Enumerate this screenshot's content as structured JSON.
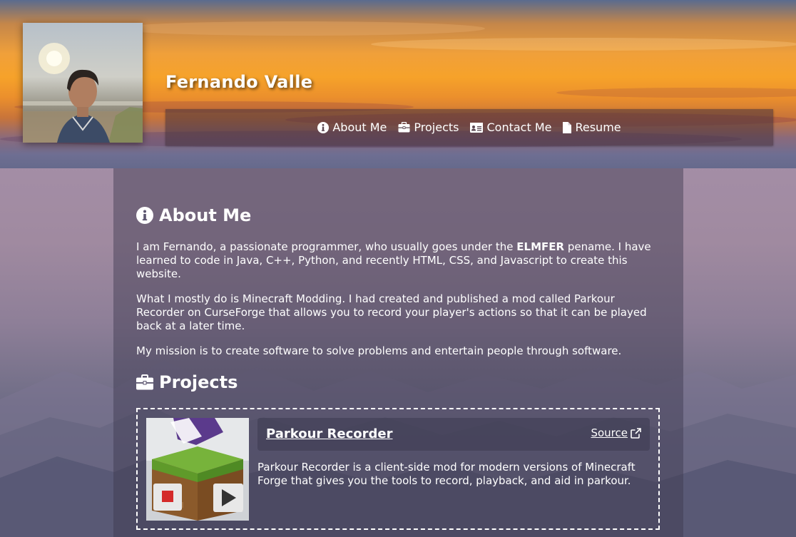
{
  "header": {
    "title": "Fernando Valle",
    "nav": [
      {
        "icon": "info-circle-icon",
        "label": "About Me"
      },
      {
        "icon": "briefcase-icon",
        "label": "Projects"
      },
      {
        "icon": "id-card-icon",
        "label": "Contact Me"
      },
      {
        "icon": "file-icon",
        "label": "Resume"
      }
    ]
  },
  "about": {
    "heading": "About Me",
    "p1_before": "I am Fernando, a passionate programmer, who usually goes under the ",
    "p1_bold": "ELMFER",
    "p1_after": " pename. I have learned to code in Java, C++, Python, and recently HTML, CSS, and Javascript to create this website.",
    "p2": "What I mostly do is Minecraft Modding. I had created and published a mod called Parkour Recorder on CurseForge that allows you to record your player's actions so that it can be played back at a later time.",
    "p3": "My mission is to create software to solve problems and entertain people through software."
  },
  "projects": {
    "heading": "Projects",
    "items": [
      {
        "name": "Parkour Recorder",
        "source_label": "Source",
        "description": "Parkour Recorder is a client-side mod for modern versions of Minecraft Forge that gives you the tools to record, playback, and aid in parkour."
      }
    ]
  },
  "colors": {
    "accent_text": "#ffffff",
    "nav_bg": "#46323c",
    "panel_bg": "#3c384e"
  }
}
